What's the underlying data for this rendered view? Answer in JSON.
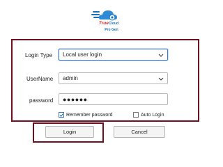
{
  "logo": {
    "brand_part1": "True",
    "brand_part2": "Cloud",
    "subtitle": "Pro Gen",
    "icon": "cloud-logo-icon",
    "accent": "#1b6fb7",
    "brand_color": "#d62728"
  },
  "form": {
    "login_type_label": "Login Type",
    "login_type_value": "Local user login",
    "username_label": "UserName",
    "username_value": "admin",
    "password_label": "password",
    "password_value": "●●●●●●",
    "remember_label": "Remember password",
    "remember_checked": true,
    "autologin_label": "Auto Login",
    "autologin_checked": false
  },
  "buttons": {
    "login": "Login",
    "cancel": "Cancel"
  },
  "colors": {
    "frame": "#6e0f1f",
    "focus": "#3b78c6"
  }
}
